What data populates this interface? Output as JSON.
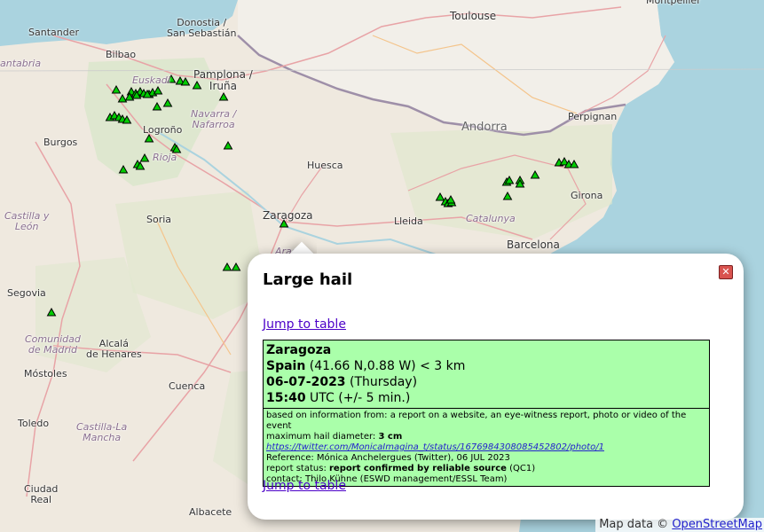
{
  "map": {
    "places": [
      {
        "id": "santander",
        "label": "Santander",
        "kind": "city"
      },
      {
        "id": "bilbao",
        "label": "Bilbao",
        "kind": "city"
      },
      {
        "id": "donostia",
        "label": "Donostia /\nSan Sebastián",
        "kind": "city"
      },
      {
        "id": "pamplona",
        "label": "Pamplona /\nIruña",
        "kind": "city"
      },
      {
        "id": "euskadi",
        "label": "Euskadi",
        "kind": "region"
      },
      {
        "id": "navarra",
        "label": "Navarra /\nNafarroa",
        "kind": "region"
      },
      {
        "id": "logrono",
        "label": "Logroño",
        "kind": "city"
      },
      {
        "id": "rioja",
        "label": "Rioja",
        "kind": "region"
      },
      {
        "id": "burgos",
        "label": "Burgos",
        "kind": "city"
      },
      {
        "id": "cantabria",
        "label": "antabria",
        "kind": "region"
      },
      {
        "id": "soria",
        "label": "Soria",
        "kind": "city"
      },
      {
        "id": "castilla_leon",
        "label": "Castilla y\nLeón",
        "kind": "region"
      },
      {
        "id": "zaragoza",
        "label": "Zaragoza",
        "kind": "city"
      },
      {
        "id": "huesca",
        "label": "Huesca",
        "kind": "city"
      },
      {
        "id": "aragon",
        "label": "Arag",
        "kind": "region"
      },
      {
        "id": "toulouse",
        "label": "Toulouse",
        "kind": "city"
      },
      {
        "id": "montpellier",
        "label": "Montpellier",
        "kind": "city"
      },
      {
        "id": "perpignan",
        "label": "Perpignan",
        "kind": "city"
      },
      {
        "id": "andorra",
        "label": "Andorra",
        "kind": "country"
      },
      {
        "id": "girona",
        "label": "Girona",
        "kind": "city"
      },
      {
        "id": "lleida",
        "label": "Lleida",
        "kind": "city"
      },
      {
        "id": "catalunya",
        "label": "Catalunya",
        "kind": "region"
      },
      {
        "id": "barcelona",
        "label": "Barcelona",
        "kind": "city"
      },
      {
        "id": "segovia",
        "label": "Segovia",
        "kind": "city"
      },
      {
        "id": "comunidad",
        "label": "Comunidad\nde Madrid",
        "kind": "region"
      },
      {
        "id": "alcala",
        "label": "Alcalá\nde Henares",
        "kind": "city"
      },
      {
        "id": "mostoles",
        "label": "Móstoles",
        "kind": "city"
      },
      {
        "id": "cuenca",
        "label": "Cuenca",
        "kind": "city"
      },
      {
        "id": "toledo",
        "label": "Toledo",
        "kind": "city"
      },
      {
        "id": "castilla_mancha",
        "label": "Castilla-La\nMancha",
        "kind": "region"
      },
      {
        "id": "ciudad_real",
        "label": "Ciudad\nReal",
        "kind": "city"
      },
      {
        "id": "albacete",
        "label": "Albacete",
        "kind": "city"
      }
    ],
    "marker_color": "#00cc00"
  },
  "popup": {
    "title": "Large hail",
    "close_label": "✕",
    "jump_link": "Jump to table",
    "report": {
      "location": "Zaragoza",
      "country": "Spain",
      "coords": " (41.66 N,0.88 W) < 3 km",
      "date": "06-07-2023",
      "weekday": " (Thursday)",
      "time": "15:40",
      "time_note": " UTC (+/- 5 min.)",
      "based_on": "based on information from: a report on a website, an eye-witness report, photo or video of the event",
      "hail_label": "maximum hail diameter: ",
      "hail_value": "3 cm",
      "url": "https://twitter.com/MonicaImagina_t/status/1676984308085452802/photo/1",
      "reference": "Reference: Mónica Anchelergues (Twitter), 06 JUL 2023",
      "status_label": "report status: ",
      "status_value": "report confirmed by reliable source",
      "status_code": " (QC1)",
      "contact": "contact: Thilo Kühne (ESWD management/ESSL Team)"
    }
  },
  "attribution": {
    "prefix": "Map data © ",
    "link": "OpenStreetMap"
  }
}
